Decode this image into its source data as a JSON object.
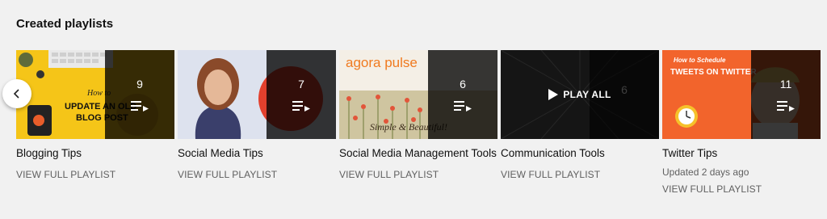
{
  "section": {
    "title": "Created playlists"
  },
  "playlists": [
    {
      "title": "Blogging Tips",
      "count": "9",
      "link": "VIEW FULL PLAYLIST",
      "thumb_text": [
        "How to",
        "UPDATE AN OLD",
        "BLOG POST"
      ]
    },
    {
      "title": "Social Media Tips",
      "count": "7",
      "link": "VIEW FULL PLAYLIST"
    },
    {
      "title": "Social Media Management Tools",
      "count": "6",
      "link": "VIEW FULL PLAYLIST",
      "thumb_text": [
        "agora pulse",
        "Simple & Beautiful!"
      ]
    },
    {
      "title": "Communication Tools",
      "count": "6",
      "link": "VIEW FULL PLAYLIST",
      "play_all": "PLAY ALL"
    },
    {
      "title": "Twitter Tips",
      "count": "11",
      "meta": "Updated 2 days ago",
      "link": "VIEW FULL PLAYLIST",
      "thumb_text": [
        "How to Schedule",
        "TWEETS ON TWITTER"
      ]
    }
  ],
  "icons": {
    "prev": "chevron-left-icon",
    "queue": "playlist-queue-icon",
    "play": "play-icon"
  }
}
